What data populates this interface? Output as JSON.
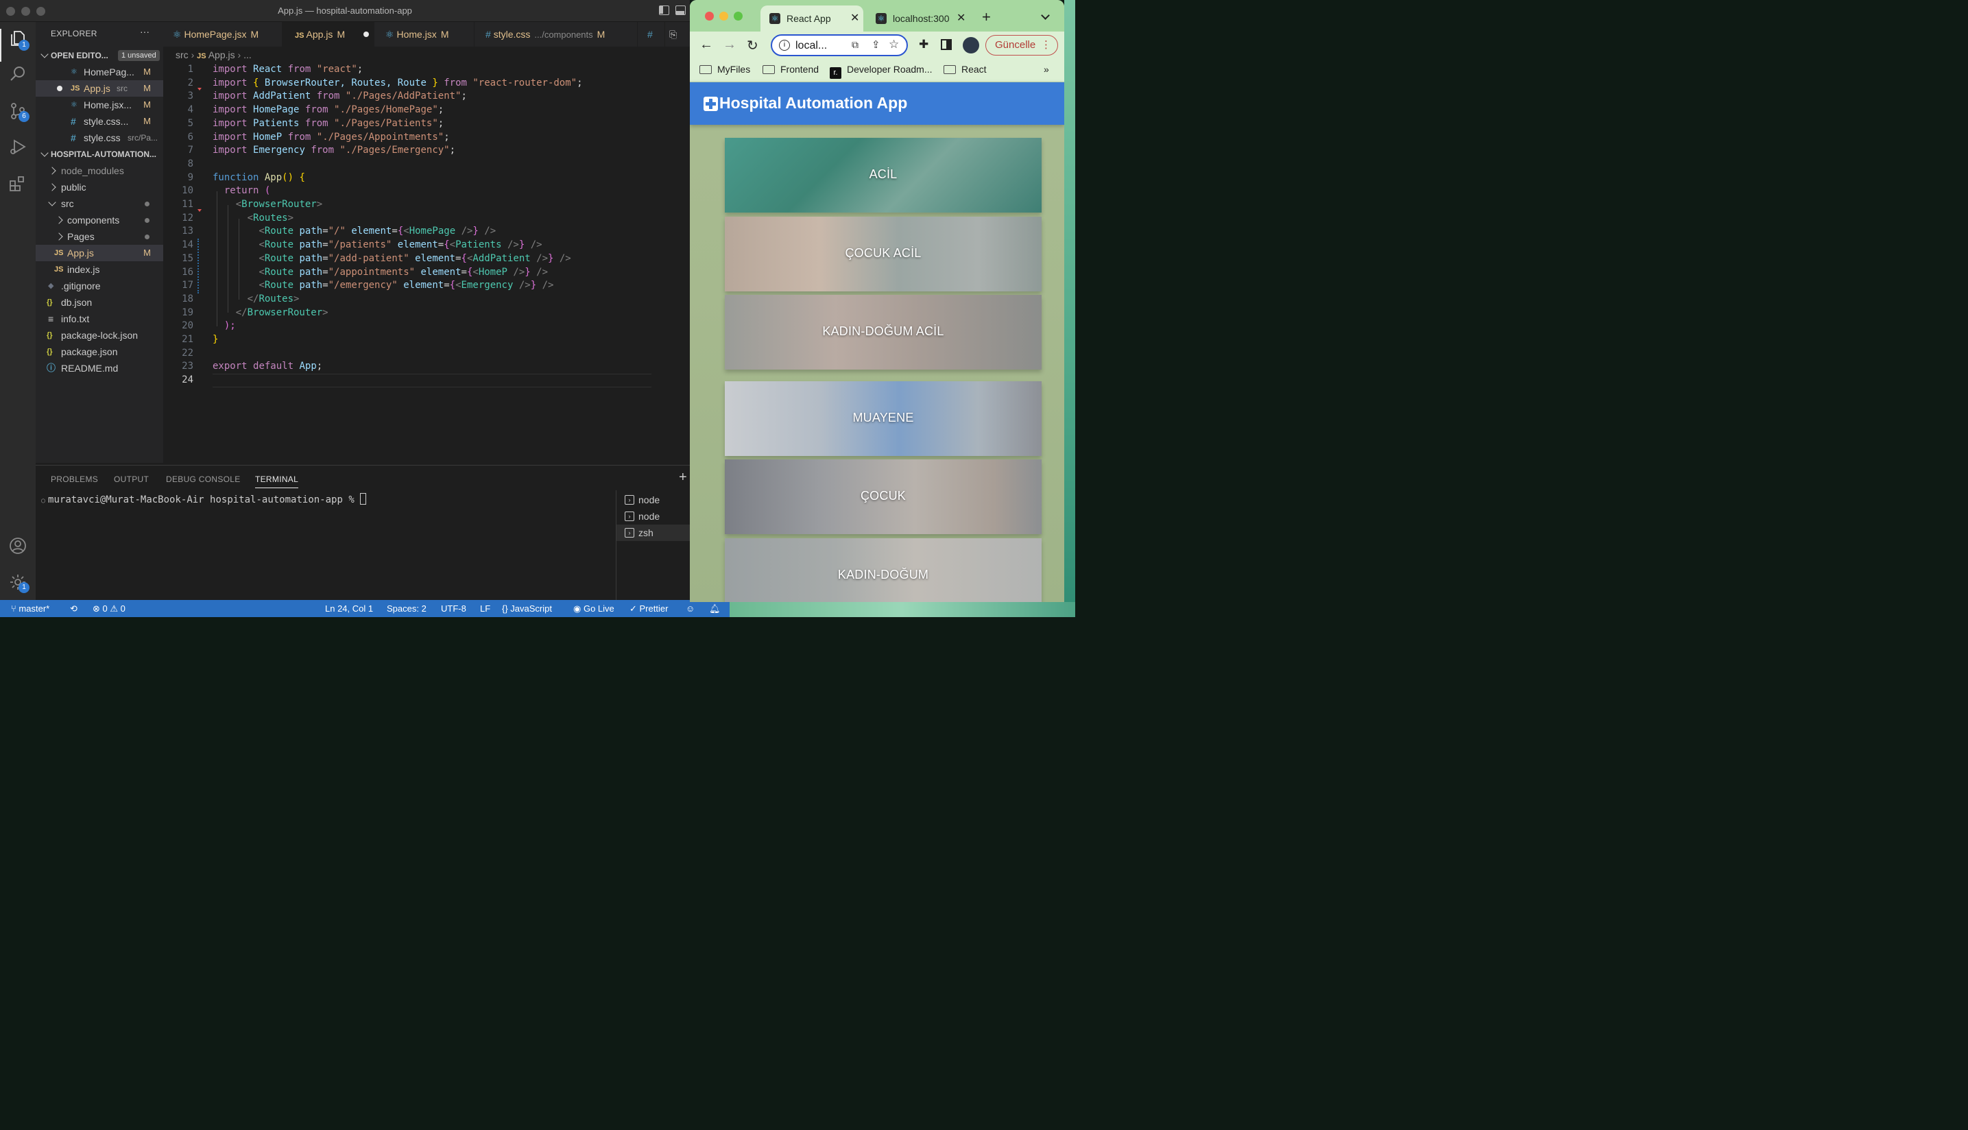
{
  "window": {
    "title": "App.js — hospital-automation-app"
  },
  "activity": {
    "explorer_badge": "1",
    "scm_badge": "6",
    "settings_badge": "1"
  },
  "explorer": {
    "header": "EXPLORER",
    "more": "···",
    "open_editors_label": "OPEN EDITO...",
    "unsaved_label": "1 unsaved",
    "open_editors": [
      {
        "name": "HomePag...",
        "sub": "",
        "status": "M"
      },
      {
        "name": "App.js",
        "sub": "src",
        "status": "M"
      },
      {
        "name": "Home.jsx...",
        "sub": "",
        "status": "M"
      },
      {
        "name": "style.css...",
        "sub": "",
        "status": "M"
      },
      {
        "name": "style.css",
        "sub": "src/Pa...",
        "status": ""
      }
    ],
    "project_label": "HOSPITAL-AUTOMATION...",
    "tree": [
      {
        "name": "node_modules"
      },
      {
        "name": "public"
      },
      {
        "name": "src"
      },
      {
        "name": "components"
      },
      {
        "name": "Pages"
      },
      {
        "name": "App.js",
        "status": "M"
      },
      {
        "name": "index.js"
      },
      {
        "name": ".gitignore"
      },
      {
        "name": "db.json"
      },
      {
        "name": "info.txt"
      },
      {
        "name": "package-lock.json"
      },
      {
        "name": "package.json"
      },
      {
        "name": "README.md"
      }
    ]
  },
  "tabs": [
    {
      "name": "HomePage.jsx",
      "status": "M",
      "sub": ""
    },
    {
      "name": "App.js",
      "status": "M",
      "sub": ""
    },
    {
      "name": "Home.jsx",
      "status": "M",
      "sub": ""
    },
    {
      "name": "style.css",
      "status": "M",
      "sub": ".../components"
    },
    {
      "name": "#",
      "status": "",
      "sub": ""
    }
  ],
  "breadcrumb": {
    "folder": "src",
    "file": "App.js",
    "more": "..."
  },
  "code": {
    "line_numbers": [
      "1",
      "2",
      "3",
      "4",
      "5",
      "6",
      "7",
      "8",
      "9",
      "10",
      "11",
      "12",
      "13",
      "14",
      "15",
      "16",
      "17",
      "18",
      "19",
      "20",
      "21",
      "22",
      "23",
      "24"
    ],
    "lines": {
      "l1": [
        "import",
        "React",
        "from",
        "\"react\"",
        ";"
      ],
      "l2": [
        "import",
        "{",
        "BrowserRouter, Routes, Route",
        "}",
        "from",
        "\"react-router-dom\"",
        ";"
      ],
      "l3": [
        "import",
        "AddPatient",
        "from",
        "\"./Pages/AddPatient\"",
        ";"
      ],
      "l4": [
        "import",
        "HomePage",
        "from",
        "\"./Pages/HomePage\"",
        ";"
      ],
      "l5": [
        "import",
        "Patients",
        "from",
        "\"./Pages/Patients\"",
        ";"
      ],
      "l6": [
        "import",
        "HomeP",
        "from",
        "\"./Pages/Appointments\"",
        ";"
      ],
      "l7": [
        "import",
        "Emergency",
        "from",
        "\"./Pages/Emergency\"",
        ";"
      ],
      "l9": [
        "function",
        "App",
        "()",
        "{"
      ],
      "l10": [
        "return",
        "("
      ],
      "l11": [
        "<",
        "BrowserRouter",
        ">"
      ],
      "l12": [
        "<",
        "Routes",
        ">"
      ],
      "l13": [
        "<",
        "Route",
        "path",
        "=",
        "\"/\"",
        "element",
        "=",
        "{",
        "<",
        "HomePage",
        "/>",
        "}",
        "/>"
      ],
      "l14": [
        "<",
        "Route",
        "path",
        "=",
        "\"/patients\"",
        "element",
        "=",
        "{",
        "<",
        "Patients",
        "/>",
        "}",
        "/>"
      ],
      "l15": [
        "<",
        "Route",
        "path",
        "=",
        "\"/add-patient\"",
        "element",
        "=",
        "{",
        "<",
        "AddPatient",
        "/>",
        "}",
        "/>"
      ],
      "l16": [
        "<",
        "Route",
        "path",
        "=",
        "\"/appointments\"",
        "element",
        "=",
        "{",
        "<",
        "HomeP",
        "/>",
        "}",
        "/>"
      ],
      "l17": [
        "<",
        "Route",
        "path",
        "=",
        "\"/emergency\"",
        "element",
        "=",
        "{",
        "<",
        "Emergency",
        "/>",
        "}",
        "/>"
      ],
      "l18": [
        "</",
        "Routes",
        ">"
      ],
      "l19": [
        "</",
        "BrowserRouter",
        ">"
      ],
      "l20": [
        ");"
      ],
      "l21": [
        "}"
      ],
      "l23": [
        "export",
        "default",
        "App",
        ";"
      ]
    }
  },
  "panel": {
    "tabs": [
      "PROBLEMS",
      "OUTPUT",
      "DEBUG CONSOLE",
      "TERMINAL"
    ],
    "active_tab": "TERMINAL",
    "prompt": "muratavci@Murat-MacBook-Air hospital-automation-app %",
    "terminals": [
      "node",
      "node",
      "zsh"
    ]
  },
  "statusbar": {
    "branch": "master*",
    "errors": "0",
    "warnings": "0",
    "position": "Ln 24, Col 1",
    "spaces": "Spaces: 2",
    "encoding": "UTF-8",
    "eol": "LF",
    "language": "JavaScript",
    "golive": "Go Live",
    "prettier": "Prettier"
  },
  "browser": {
    "tabs": [
      {
        "title": "React App",
        "active": true
      },
      {
        "title": "localhost:300",
        "active": false
      }
    ],
    "url": "local...",
    "update_label": "Güncelle",
    "bookmarks": [
      "MyFiles",
      "Frontend",
      "Developer Roadm...",
      "React"
    ],
    "bookmarks_more": "»",
    "colors": {
      "appbar": "#3a7bd5",
      "update": "#b23b35"
    }
  },
  "app": {
    "title": "Hospital Automation App",
    "cards": [
      "ACİL",
      "ÇOCUK ACİL",
      "KADIN-DOĞUM ACİL",
      "MUAYENE",
      "ÇOCUK",
      "KADIN-DOĞUM"
    ]
  }
}
